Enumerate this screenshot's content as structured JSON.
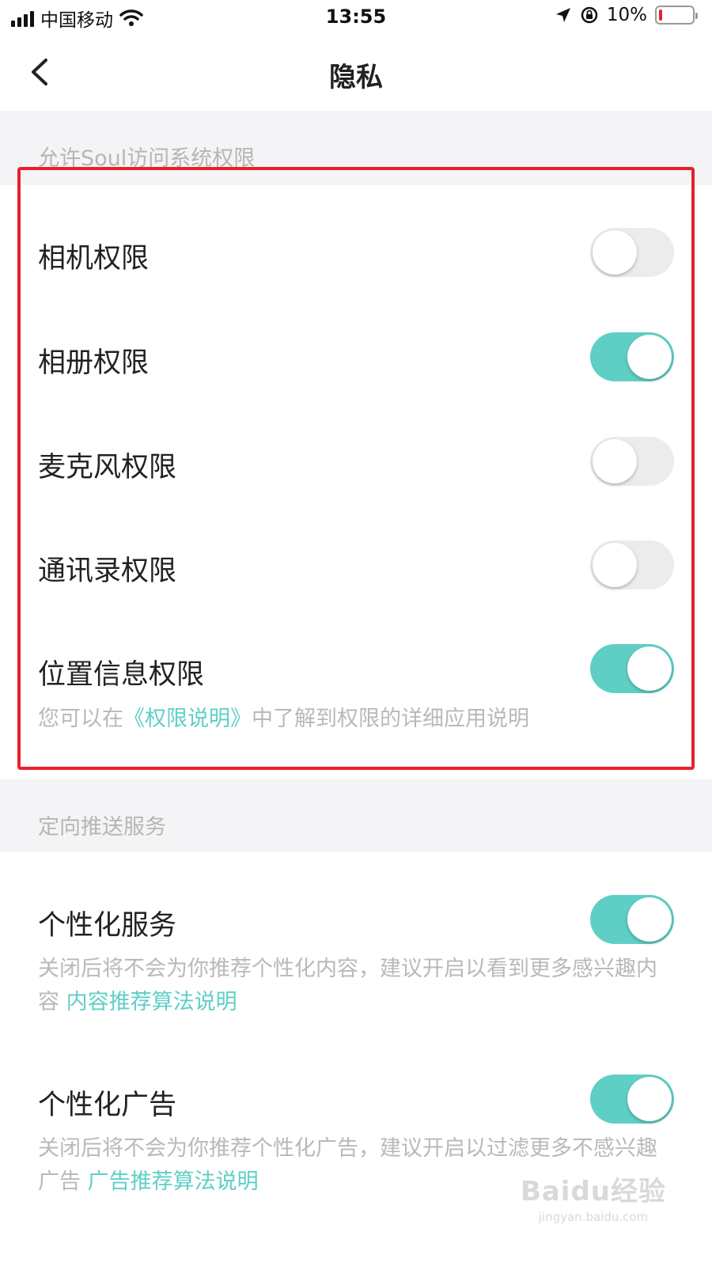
{
  "status_bar": {
    "carrier": "中国移动",
    "time": "13:55",
    "battery_percent": "10%",
    "battery_level": 0.1,
    "battery_color": "#e8202a"
  },
  "nav": {
    "title": "隐私",
    "back_icon": "chevron-left-icon"
  },
  "sections": {
    "system_permissions": {
      "header": "允许Soul访问系统权限",
      "items": [
        {
          "label": "相机权限",
          "enabled": false
        },
        {
          "label": "相册权限",
          "enabled": true
        },
        {
          "label": "麦克风权限",
          "enabled": false
        },
        {
          "label": "通讯录权限",
          "enabled": false
        },
        {
          "label": "位置信息权限",
          "enabled": true
        }
      ],
      "note_prefix": "您可以在",
      "note_link": "《权限说明》",
      "note_suffix": "中了解到权限的详细应用说明"
    },
    "targeted_push": {
      "header": "定向推送服务",
      "items": [
        {
          "label": "个性化服务",
          "enabled": true,
          "note": "关闭后将不会为你推荐个性化内容，建议开启以看到更多感兴趣内容",
          "link": "内容推荐算法说明"
        },
        {
          "label": "个性化广告",
          "enabled": true,
          "note": "关闭后将不会为你推荐个性化广告，建议开启以过滤更多不感兴趣广告",
          "link": "广告推荐算法说明"
        }
      ]
    }
  },
  "colors": {
    "accent": "#5fcfc6",
    "highlight_border": "#e8202a",
    "toggle_off": "#ececec",
    "section_bg": "#f4f4f6"
  },
  "watermark": {
    "brand": "Baidu经验",
    "url": "jingyan.baidu.com"
  }
}
